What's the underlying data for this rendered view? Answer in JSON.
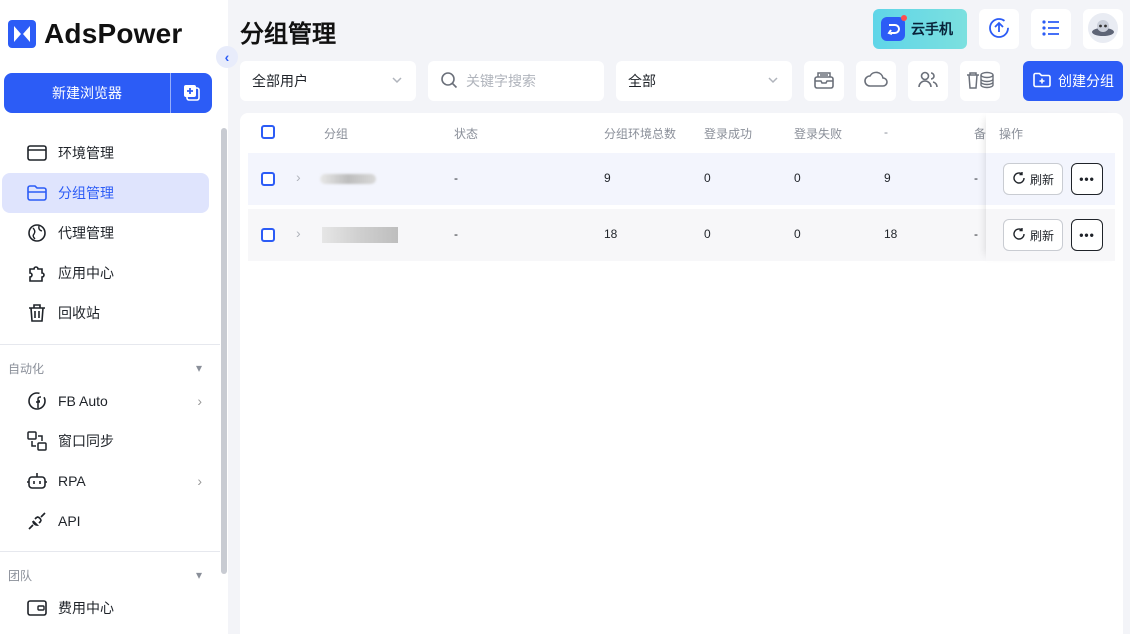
{
  "app": {
    "name": "AdsPower",
    "brand_color": "#2c5cf6"
  },
  "sidebar": {
    "new_browser_label": "新建浏览器",
    "items": [
      {
        "label": "环境管理",
        "icon": "browser-window-icon",
        "active": false
      },
      {
        "label": "分组管理",
        "icon": "folder-icon",
        "active": true
      },
      {
        "label": "代理管理",
        "icon": "globe-icon",
        "active": false
      },
      {
        "label": "应用中心",
        "icon": "puzzle-icon",
        "active": false
      },
      {
        "label": "回收站",
        "icon": "trash-icon",
        "active": false
      }
    ],
    "automation_title": "自动化",
    "automation_items": [
      {
        "label": "FB Auto",
        "icon": "facebook-icon",
        "has_arrow": true
      },
      {
        "label": "窗口同步",
        "icon": "window-sync-icon",
        "has_arrow": false
      },
      {
        "label": "RPA",
        "icon": "robot-icon",
        "has_arrow": true
      },
      {
        "label": "API",
        "icon": "plug-icon",
        "has_arrow": false
      }
    ],
    "team_title": "团队",
    "team_items": [
      {
        "label": "费用中心",
        "icon": "wallet-icon"
      }
    ]
  },
  "header": {
    "title": "分组管理",
    "cloud_phone_label": "云手机"
  },
  "filters": {
    "users": "全部用户",
    "search_placeholder": "关键字搜索",
    "scope": "全部",
    "create_group": "创建分组"
  },
  "table": {
    "columns": [
      "分组",
      "状态",
      "分组环境总数",
      "登录成功",
      "登录失败",
      "-",
      "备",
      "操作"
    ],
    "rows": [
      {
        "status": "-",
        "total": "9",
        "success": "0",
        "fail": "0",
        "extra": "9",
        "note": "-",
        "refresh": "刷新",
        "more": "•••"
      },
      {
        "status": "-",
        "total": "18",
        "success": "0",
        "fail": "0",
        "extra": "18",
        "note": "-",
        "refresh": "刷新",
        "more": "•••"
      }
    ]
  }
}
